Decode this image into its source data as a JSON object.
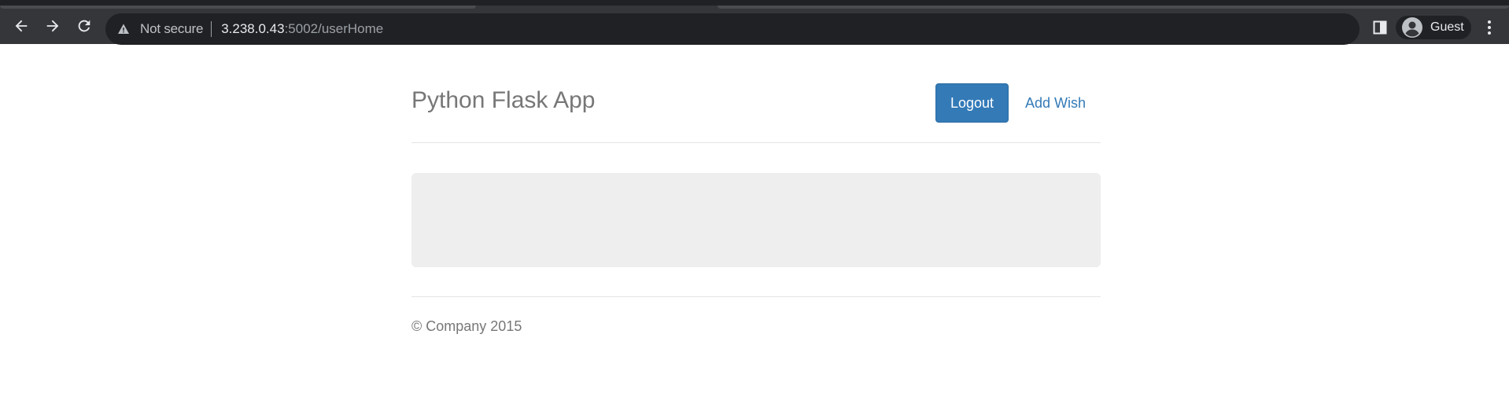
{
  "browser": {
    "security_label": "Not secure",
    "url_host": "3.238.0.43",
    "url_rest": ":5002/userHome",
    "profile_label": "Guest"
  },
  "header": {
    "title": "Python Flask App",
    "logout_label": "Logout",
    "add_wish_label": "Add Wish"
  },
  "footer": {
    "text": "© Company 2015"
  },
  "colors": {
    "primary": "#337ab7",
    "jumbotron": "#eeeeee",
    "browser_chrome": "#35363a"
  }
}
